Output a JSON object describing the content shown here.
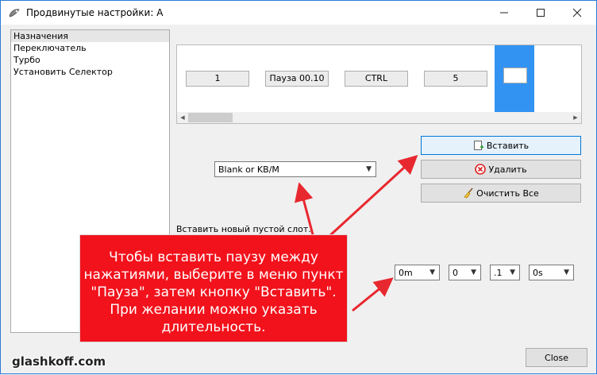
{
  "window": {
    "title": "Продвинутые настройки: A"
  },
  "window_controls": {
    "minimize": "—",
    "maximize": "☐",
    "close": "✕"
  },
  "sidebar": {
    "items": [
      {
        "label": "Назначения",
        "selected": true
      },
      {
        "label": "Переключатель",
        "selected": false
      },
      {
        "label": "Турбо",
        "selected": false
      },
      {
        "label": "Установить Селектор",
        "selected": false
      }
    ]
  },
  "slots": {
    "items": [
      "1",
      "Пауза 00.10",
      "CTRL",
      "5",
      ""
    ]
  },
  "scrollbar": {
    "left": "◀",
    "right": "▶"
  },
  "actions": {
    "insert": "Вставить",
    "delete": "Удалить",
    "clear_all": "Очистить Все"
  },
  "type_select": {
    "value": "Blank or KB/M",
    "arrow": "▼"
  },
  "hint": "Вставить новый пустой слот.",
  "pause": {
    "minutes": "0m",
    "seconds": "0",
    "fraction": ".1",
    "extra": "0s",
    "arrow": "▼"
  },
  "callout": {
    "lines": [
      "Чтобы вставить паузу между",
      "нажатиями, выберите в меню пункт",
      "\"Пауза\", затем кнопку \"Вставить\".",
      "При желании можно указать",
      "длительность."
    ]
  },
  "watermark": "glashkoff.com",
  "footer": {
    "close": "Close"
  },
  "colors": {
    "accent": "#0078d7",
    "selection": "#3393f3",
    "callout_bg": "#f2121c",
    "arrow": "#e8282f"
  }
}
